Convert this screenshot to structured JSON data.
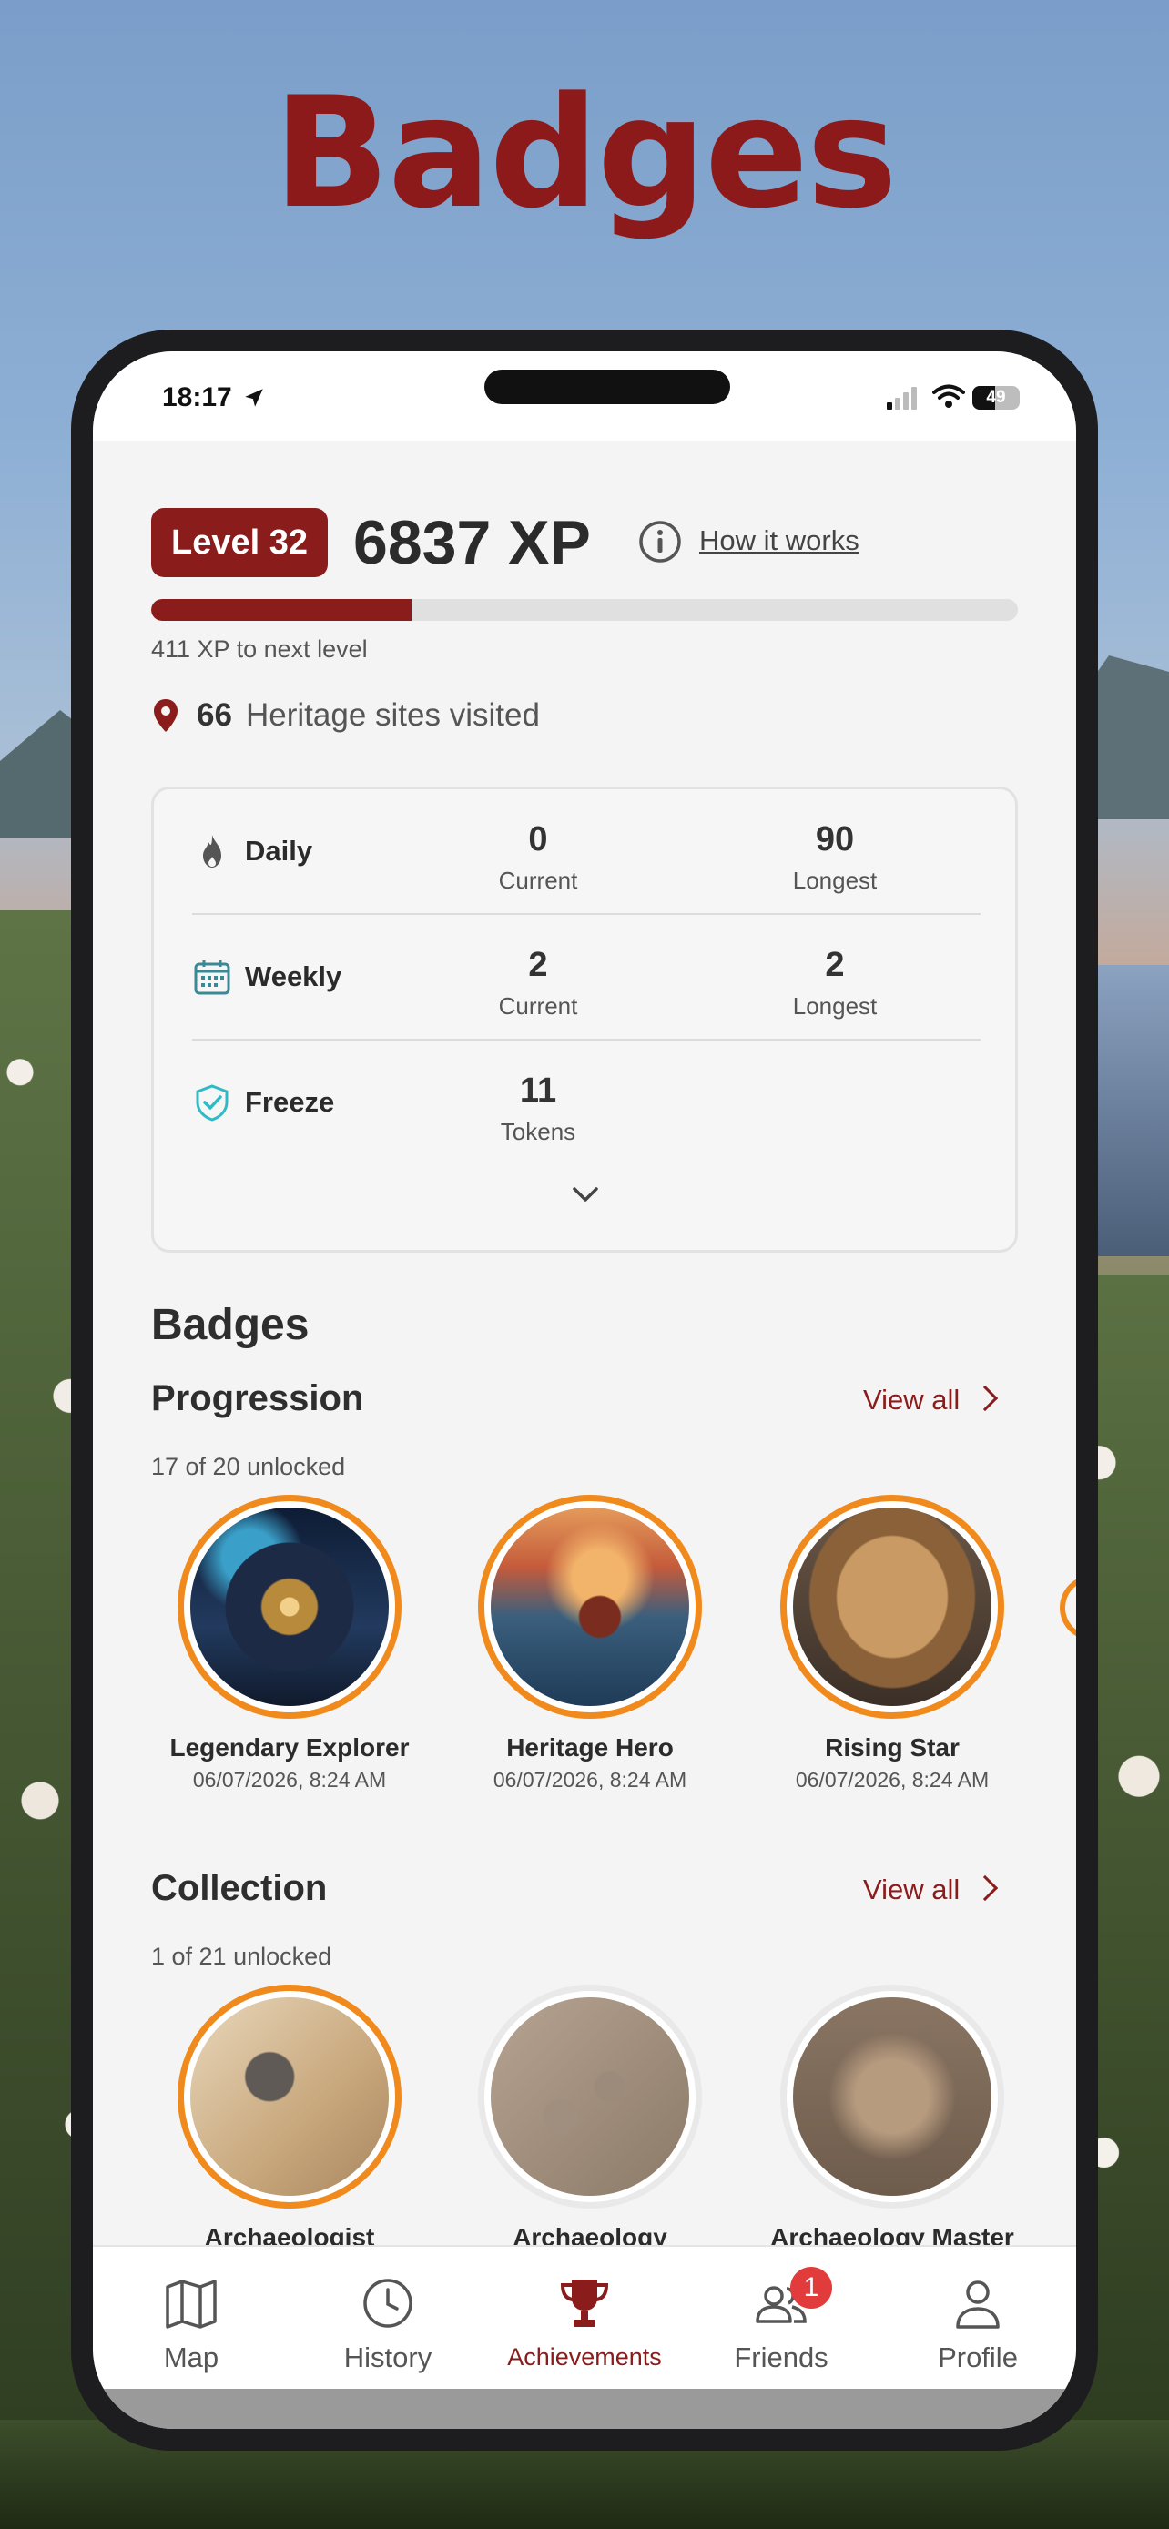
{
  "page_title": "Badges",
  "status_bar": {
    "time": "18:17",
    "battery": "49"
  },
  "header": {
    "level_label": "Level 32",
    "xp_total": "6837 XP",
    "how_it_works": "How it works",
    "progress_fraction": 0.3,
    "next_level_text": "411 XP to next level",
    "sites_count": "66",
    "sites_label": "Heritage sites visited"
  },
  "streaks": {
    "daily": {
      "label": "Daily",
      "current": "0",
      "current_label": "Current",
      "longest": "90",
      "longest_label": "Longest"
    },
    "weekly": {
      "label": "Weekly",
      "current": "2",
      "current_label": "Current",
      "longest": "2",
      "longest_label": "Longest"
    },
    "freeze": {
      "label": "Freeze",
      "tokens": "11",
      "tokens_label": "Tokens"
    }
  },
  "badges": {
    "title": "Badges",
    "progression": {
      "title": "Progression",
      "view_all": "View all",
      "unlocked": "17 of 20 unlocked",
      "items": [
        {
          "name": "Legendary Explorer",
          "date": "06/07/2026, 8:24 AM"
        },
        {
          "name": "Heritage Hero",
          "date": "06/07/2026, 8:24 AM"
        },
        {
          "name": "Rising Star",
          "date": "06/07/2026, 8:24 AM"
        }
      ]
    },
    "collection": {
      "title": "Collection",
      "view_all": "View all",
      "unlocked": "1 of 21 unlocked",
      "items": [
        {
          "name": "Archaeologist"
        },
        {
          "name": "Archaeology"
        },
        {
          "name": "Archaeology Master"
        }
      ]
    }
  },
  "tabbar": {
    "items": [
      {
        "label": "Map",
        "icon": "map-icon"
      },
      {
        "label": "History",
        "icon": "clock-icon"
      },
      {
        "label": "Achievements",
        "icon": "trophy-icon"
      },
      {
        "label": "Friends",
        "icon": "friends-icon",
        "badge": "1"
      },
      {
        "label": "Profile",
        "icon": "person-icon"
      }
    ]
  },
  "colors": {
    "accent": "#8b1c1c",
    "badge_ring": "#f08a1d",
    "notification": "#e23b3b"
  }
}
